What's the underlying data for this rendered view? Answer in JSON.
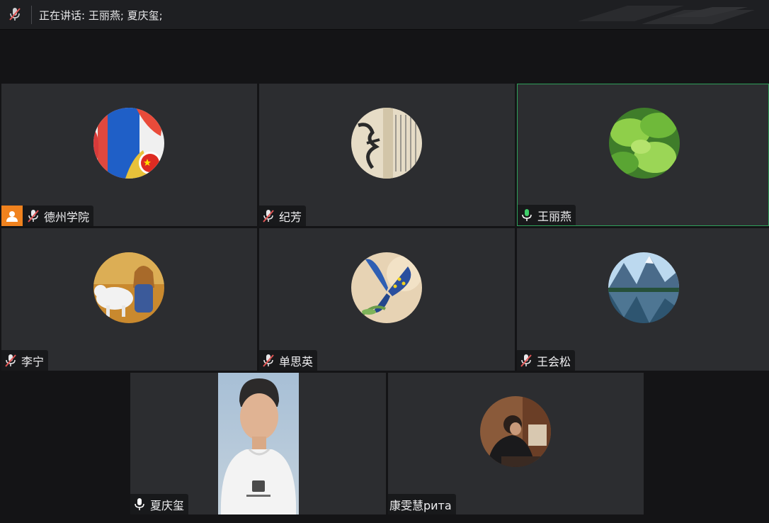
{
  "topbar": {
    "speaking_text": "正在讲话: 王丽燕; 夏庆玺;"
  },
  "participants": [
    {
      "name": "德州学院",
      "mic": "muted",
      "host": true
    },
    {
      "name": "纪芳",
      "mic": "muted"
    },
    {
      "name": "王丽燕",
      "mic": "active",
      "speaking": true
    },
    {
      "name": "李宁",
      "mic": "muted"
    },
    {
      "name": "单思英",
      "mic": "muted"
    },
    {
      "name": "王会松",
      "mic": "muted"
    },
    {
      "name": "夏庆玺",
      "mic": "active",
      "video": true
    },
    {
      "name": "康雯慧рита",
      "mic": "none"
    }
  ],
  "colors": {
    "active_border": "#2f9f5a",
    "host_badge": "#f0821e",
    "muted_icon": "#e05555"
  }
}
